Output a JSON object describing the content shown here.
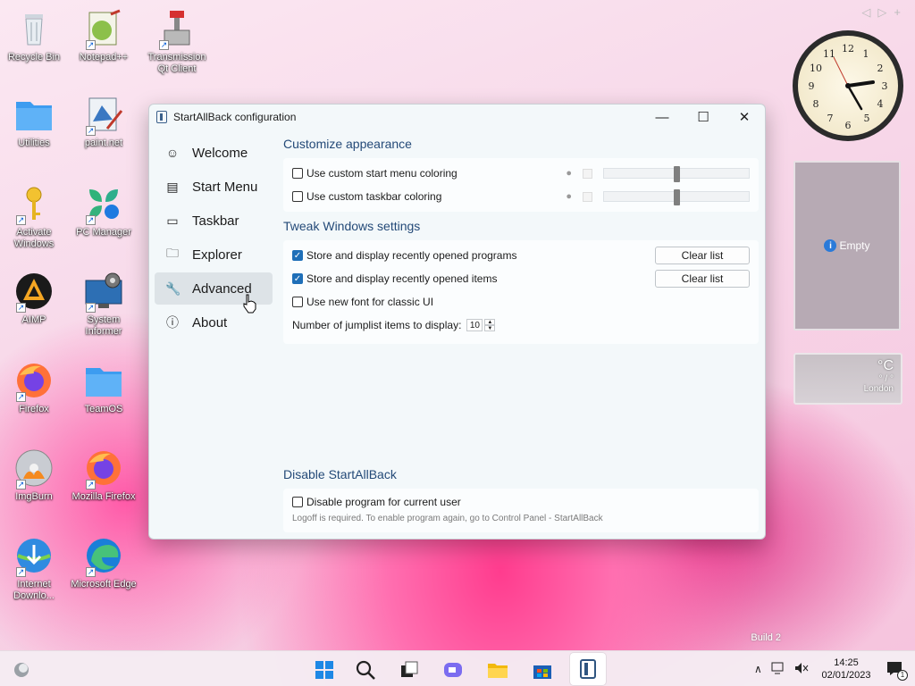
{
  "desktop": {
    "icons": [
      {
        "label": "Recycle Bin",
        "shortcut": false
      },
      {
        "label": "Notepad++",
        "shortcut": true
      },
      {
        "label": "Transmission Qt Client",
        "shortcut": true
      },
      {
        "label": "Utilities",
        "shortcut": false
      },
      {
        "label": "paint.net",
        "shortcut": true
      },
      {
        "label": "Activate Windows",
        "shortcut": true
      },
      {
        "label": "PC Manager",
        "shortcut": true
      },
      {
        "label": "AIMP",
        "shortcut": true
      },
      {
        "label": "System Informer",
        "shortcut": true
      },
      {
        "label": "Firefox",
        "shortcut": true
      },
      {
        "label": "TeamOS",
        "shortcut": false
      },
      {
        "label": "ImgBurn",
        "shortcut": true
      },
      {
        "label": "Mozilla Firefox",
        "shortcut": true
      },
      {
        "label": "Internet Downlo...",
        "shortcut": true
      },
      {
        "label": "Microsoft Edge",
        "shortcut": true
      }
    ],
    "watermark": "Build 2"
  },
  "widgets": {
    "nav_prev": "◁",
    "nav_next": "▷",
    "nav_add": "+",
    "gadget_empty_text": "Empty",
    "weather": {
      "temp": "°C",
      "range": "° / °",
      "city": "London"
    }
  },
  "window": {
    "title": "StartAllBack configuration",
    "controls": {
      "minimize": "—",
      "maximize": "☐",
      "close": "✕"
    },
    "nav": [
      {
        "label": "Welcome",
        "icon": "smile-icon",
        "glyph": "☺",
        "active": false
      },
      {
        "label": "Start Menu",
        "icon": "start-menu-icon",
        "glyph": "▤",
        "active": false
      },
      {
        "label": "Taskbar",
        "icon": "taskbar-icon",
        "glyph": "▭",
        "active": false
      },
      {
        "label": "Explorer",
        "icon": "folder-icon",
        "glyph": "🗀",
        "active": false
      },
      {
        "label": "Advanced",
        "icon": "wrench-icon",
        "glyph": "🔧",
        "active": true
      },
      {
        "label": "About",
        "icon": "info-icon",
        "glyph": "ⓘ",
        "active": false
      }
    ],
    "customize": {
      "title": "Customize appearance",
      "start_coloring": "Use custom start menu coloring",
      "taskbar_coloring": "Use custom taskbar coloring",
      "start_slider_value": 0.5,
      "taskbar_slider_value": 0.5
    },
    "tweak": {
      "title": "Tweak Windows settings",
      "recent_programs": "Store and display recently opened programs",
      "recent_items": "Store and display recently opened items",
      "new_font": "Use new font for classic UI",
      "clear_list": "Clear list",
      "jumplist_label": "Number of jumplist items to display:",
      "jumplist_value": "10"
    },
    "disable": {
      "title": "Disable StartAllBack",
      "label": "Disable program for current user",
      "note": "Logoff is required. To enable program again, go to Control Panel - StartAllBack"
    }
  },
  "taskbar": {
    "time": "14:25",
    "date": "02/01/2023",
    "notification_count": "1"
  }
}
